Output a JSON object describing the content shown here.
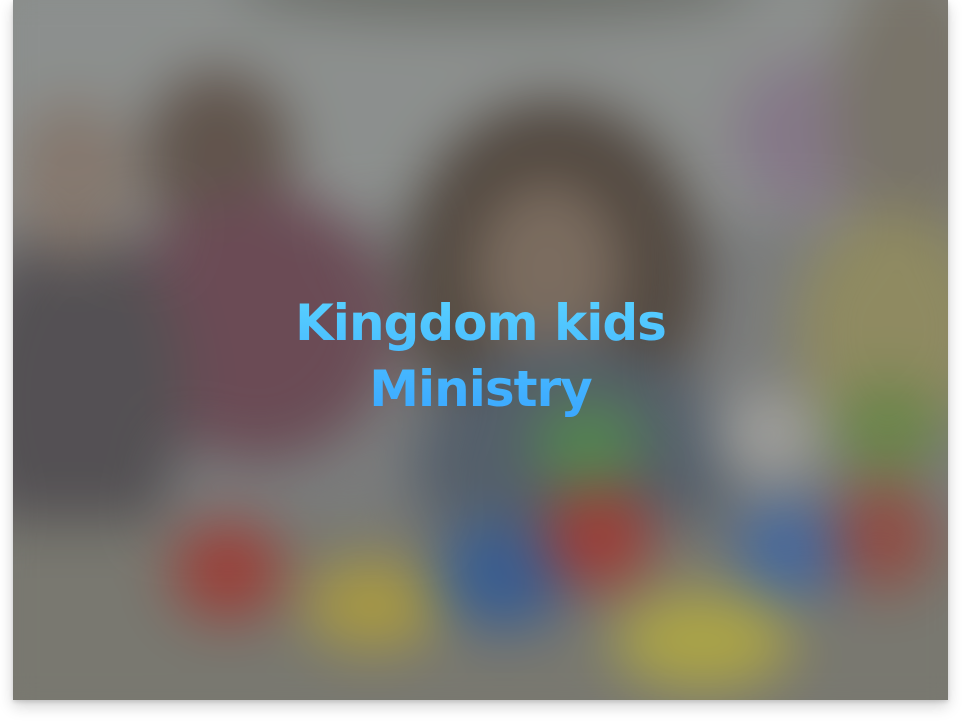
{
  "hero": {
    "title_line1": "Kingdom kids",
    "title_line2": "Ministry",
    "title_color": "#4cc3ff"
  },
  "background": {
    "image": "blurred-kids-playing-photo"
  }
}
